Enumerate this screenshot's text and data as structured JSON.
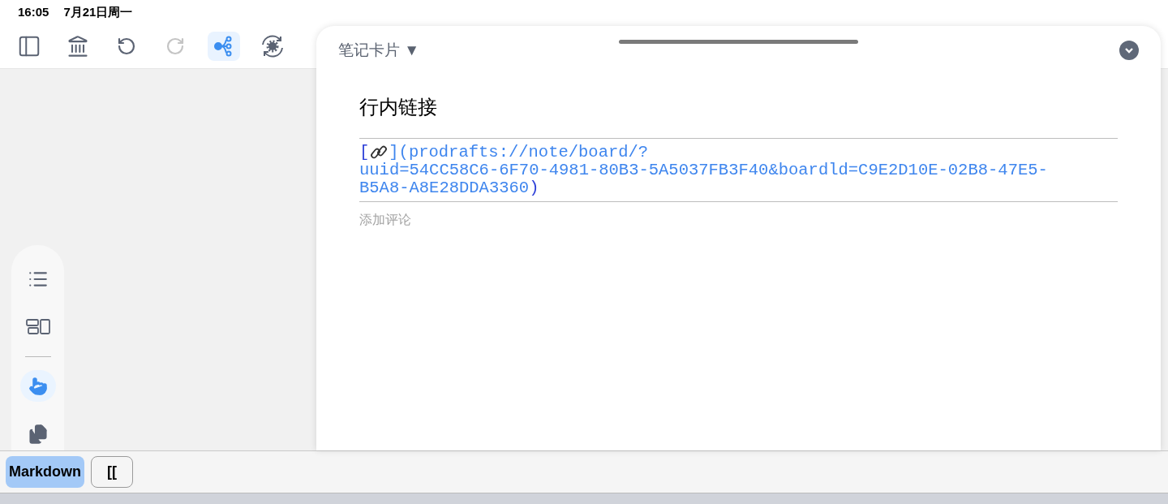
{
  "status_bar": {
    "time": "16:05",
    "date": "7月21日周一"
  },
  "toolbar": [
    {
      "kind": "sidebar",
      "selected": false,
      "disabled": false
    },
    {
      "kind": "library",
      "selected": false,
      "disabled": false
    },
    {
      "kind": "undo",
      "selected": false,
      "disabled": false
    },
    {
      "kind": "redo",
      "selected": false,
      "disabled": true
    },
    {
      "kind": "mindmap",
      "selected": true,
      "disabled": false
    },
    {
      "kind": "sync",
      "selected": false,
      "disabled": false
    }
  ],
  "side_tools": [
    {
      "kind": "list",
      "selected": false
    },
    {
      "kind": "layout",
      "selected": false
    },
    {
      "kind": "divider"
    },
    {
      "kind": "pointer",
      "selected": true
    },
    {
      "kind": "copy",
      "selected": false
    }
  ],
  "sheet": {
    "menu": "笔记卡片 ▼",
    "title": "行内链接",
    "link": {
      "open": "[",
      "lines": [
        "](prodrafts://note/board/?",
        "uuid=54CC58C6-6F70-4981-80B3-5A5037FB3F40&boardld=C9E2D10E-02B8-47E5-",
        "B5A8-A8E28DDA3360"
      ],
      "close": ")"
    },
    "comment_placeholder": "添加评论"
  },
  "keyboard_bar": [
    {
      "label": "Markdown",
      "selected": true
    },
    {
      "label": "[[",
      "selected": false
    }
  ]
}
